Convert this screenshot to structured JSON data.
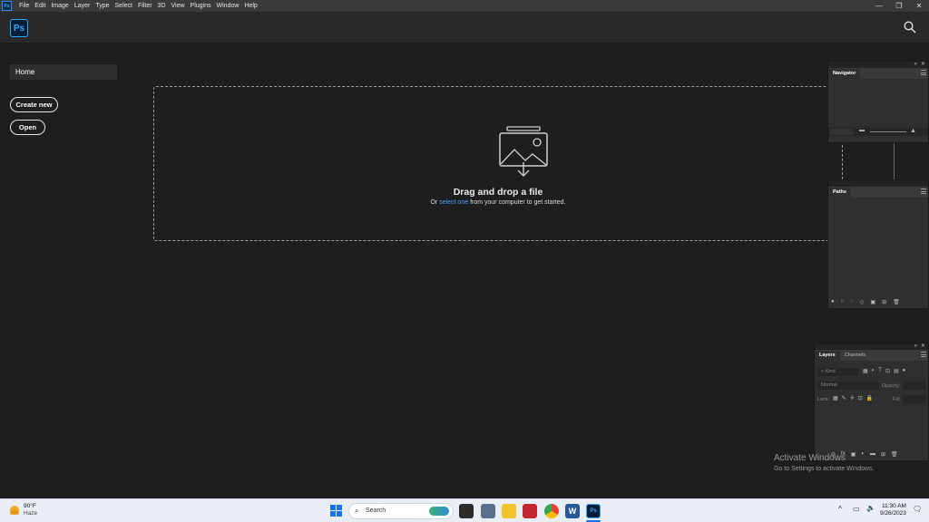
{
  "app": {
    "name": "Ps"
  },
  "menubar": {
    "items": [
      "File",
      "Edit",
      "Image",
      "Layer",
      "Type",
      "Select",
      "Filter",
      "3D",
      "View",
      "Plugins",
      "Window",
      "Help"
    ],
    "min": "—",
    "restore": "❐",
    "close": "✕"
  },
  "home": {
    "tab_label": "Home",
    "create_new": "Create new",
    "open": "Open"
  },
  "dropzone": {
    "title": "Drag and drop a file",
    "sub_prefix": "Or ",
    "sub_link": "select one",
    "sub_suffix": " from your computer to get started."
  },
  "panels": {
    "navigator": {
      "tab": "Navigator"
    },
    "paths": {
      "tab": "Paths"
    },
    "layers": {
      "tab_layers": "Layers",
      "tab_channels": "Channels",
      "kind_placeholder": "Kind",
      "blend_mode": "Normal",
      "opacity_label": "Opacity:",
      "lock_label": "Lock:",
      "fill_label": "Fill:"
    }
  },
  "watermark": {
    "line1": "Activate Windows",
    "line2": "Go to Settings to activate Windows."
  },
  "taskbar": {
    "weather_temp": "90°F",
    "weather_cond": "Haze",
    "search_label": "Search",
    "time": "11:30 AM",
    "date": "9/26/2023"
  },
  "colors": {
    "accent": "#31a8ff",
    "link": "#4aa3ff",
    "bg": "#1e1e1e"
  }
}
